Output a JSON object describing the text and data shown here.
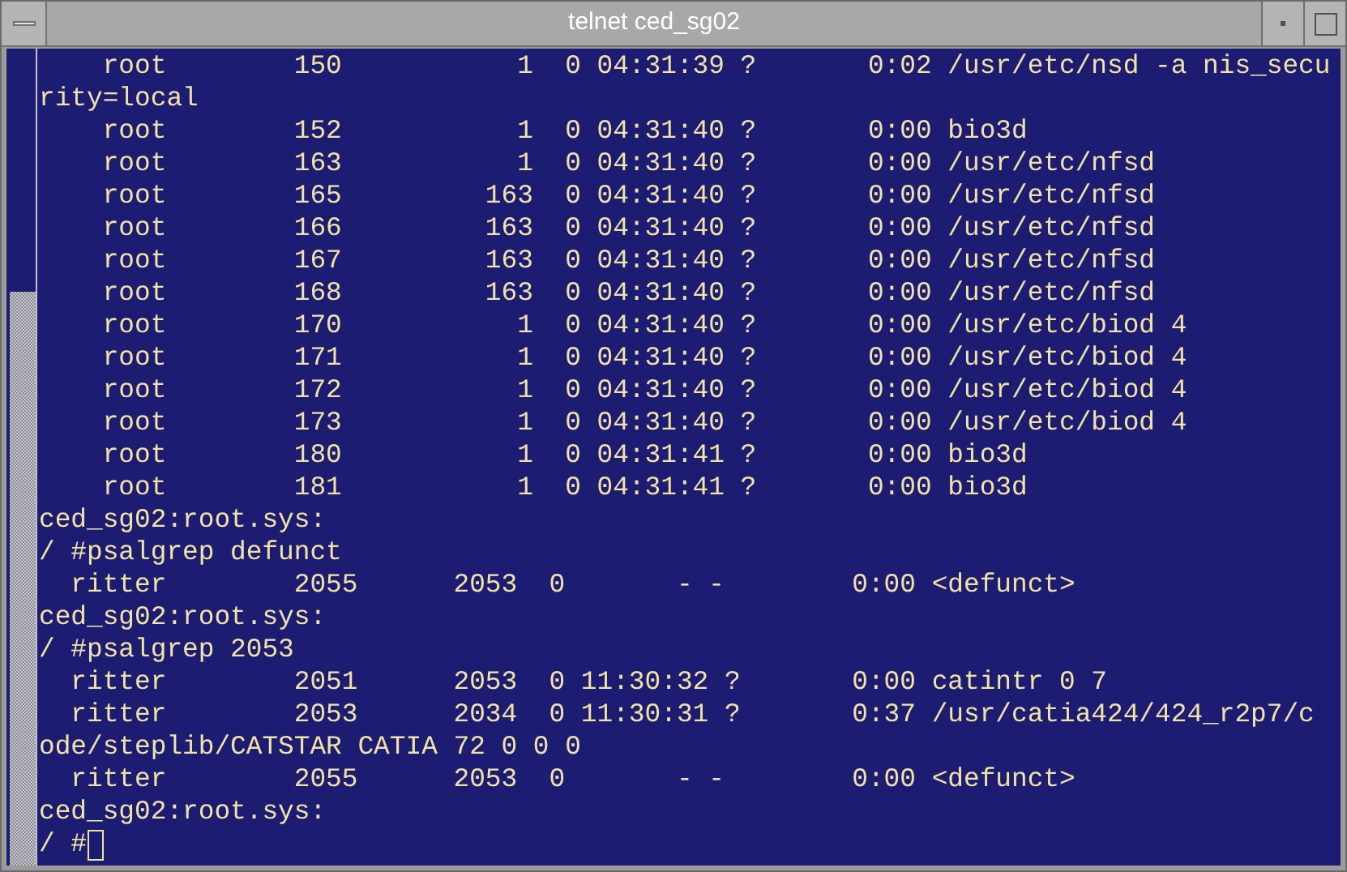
{
  "window": {
    "title": "telnet ced_sg02"
  },
  "terminal": {
    "lines": [
      "    root        150           1  0 04:31:39 ?       0:02 /usr/etc/nsd -a nis_secu",
      "rity=local",
      "    root        152           1  0 04:31:40 ?       0:00 bio3d",
      "    root        163           1  0 04:31:40 ?       0:00 /usr/etc/nfsd",
      "    root        165         163  0 04:31:40 ?       0:00 /usr/etc/nfsd",
      "    root        166         163  0 04:31:40 ?       0:00 /usr/etc/nfsd",
      "    root        167         163  0 04:31:40 ?       0:00 /usr/etc/nfsd",
      "    root        168         163  0 04:31:40 ?       0:00 /usr/etc/nfsd",
      "    root        170           1  0 04:31:40 ?       0:00 /usr/etc/biod 4",
      "    root        171           1  0 04:31:40 ?       0:00 /usr/etc/biod 4",
      "    root        172           1  0 04:31:40 ?       0:00 /usr/etc/biod 4",
      "    root        173           1  0 04:31:40 ?       0:00 /usr/etc/biod 4",
      "    root        180           1  0 04:31:41 ?       0:00 bio3d",
      "    root        181           1  0 04:31:41 ?       0:00 bio3d",
      "ced_sg02:root.sys:",
      "/ #psalgrep defunct",
      "  ritter        2055      2053  0       - -        0:00 <defunct>",
      "ced_sg02:root.sys:",
      "/ #psalgrep 2053",
      "  ritter        2051      2053  0 11:30:32 ?       0:00 catintr 0 7",
      "  ritter        2053      2034  0 11:30:31 ?       0:37 /usr/catia424/424_r2p7/c",
      "ode/steplib/CATSTAR CATIA 72 0 0 0",
      "  ritter        2055      2053  0       - -        0:00 <defunct>",
      "ced_sg02:root.sys:"
    ],
    "prompt": "/ #"
  }
}
